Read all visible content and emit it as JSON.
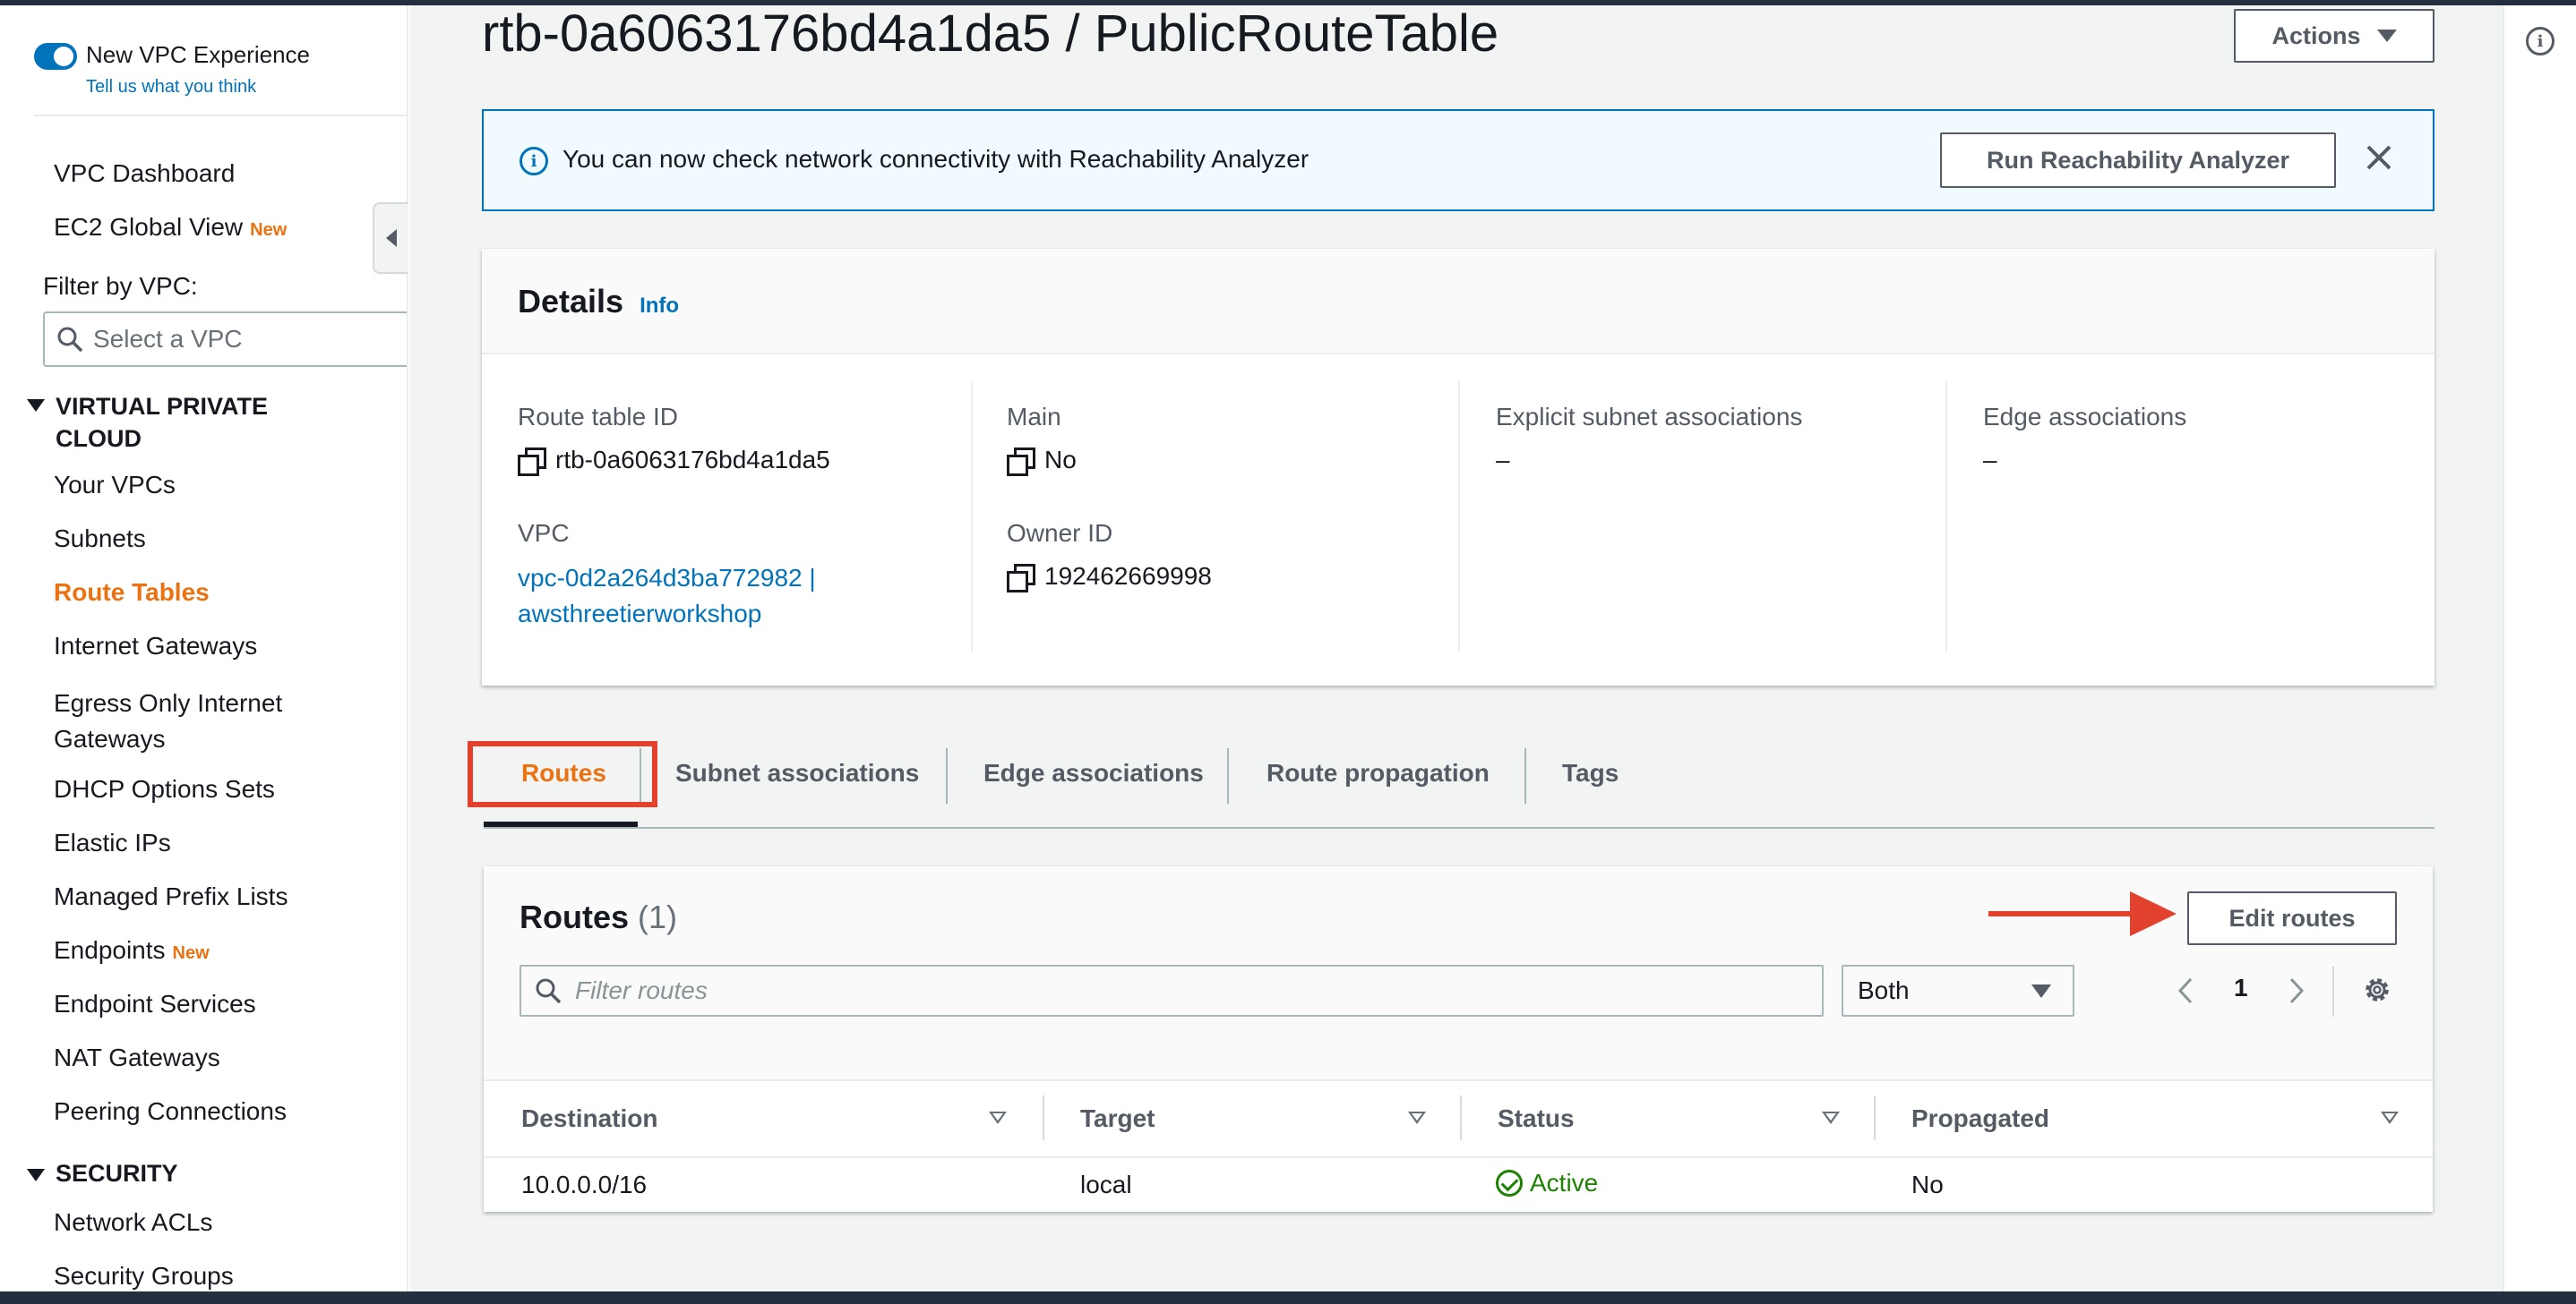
{
  "sidebar": {
    "vpc_experience_title": "New VPC Experience",
    "vpc_experience_link": "Tell us what you think",
    "dashboard": "VPC Dashboard",
    "global_view": "EC2 Global View",
    "new_badge": "New",
    "filter_label": "Filter by VPC:",
    "filter_placeholder": "Select a VPC",
    "section_vpc": "VIRTUAL PRIVATE CLOUD",
    "items": [
      "Your VPCs",
      "Subnets",
      "Route Tables",
      "Internet Gateways",
      "Egress Only Internet Gateways",
      "DHCP Options Sets",
      "Elastic IPs",
      "Managed Prefix Lists",
      "Endpoints",
      "Endpoint Services",
      "NAT Gateways",
      "Peering Connections"
    ],
    "active_item": "Route Tables",
    "section_security": "SECURITY",
    "security_items": [
      "Network ACLs",
      "Security Groups"
    ]
  },
  "header": {
    "title": "rtb-0a6063176bd4a1da5 / PublicRouteTable",
    "actions_label": "Actions"
  },
  "flash": {
    "message": "You can now check network connectivity with Reachability Analyzer",
    "button_label": "Run Reachability Analyzer"
  },
  "details": {
    "title": "Details",
    "info": "Info",
    "route_table_id_label": "Route table ID",
    "route_table_id": "rtb-0a6063176bd4a1da5",
    "vpc_label": "VPC",
    "vpc_line1": "vpc-0d2a264d3ba772982 |",
    "vpc_line2": "awsthreetierworkshop",
    "main_label": "Main",
    "main_value": "No",
    "owner_label": "Owner ID",
    "owner_value": "192462669998",
    "explicit_label": "Explicit subnet associations",
    "explicit_value": "–",
    "edge_label": "Edge associations",
    "edge_value": "–"
  },
  "tabs": [
    "Routes",
    "Subnet associations",
    "Edge associations",
    "Route propagation",
    "Tags"
  ],
  "routes": {
    "title": "Routes",
    "count": "(1)",
    "edit_label": "Edit routes",
    "filter_placeholder": "Filter routes",
    "select_value": "Both",
    "page": "1",
    "columns": [
      "Destination",
      "Target",
      "Status",
      "Propagated"
    ],
    "rows": [
      {
        "destination": "10.0.0.0/16",
        "target": "local",
        "status": "Active",
        "propagated": "No"
      }
    ]
  },
  "colors": {
    "accent": "#ec7211",
    "link": "#0073bb",
    "annotation": "#e1412d",
    "success": "#1d8102"
  }
}
